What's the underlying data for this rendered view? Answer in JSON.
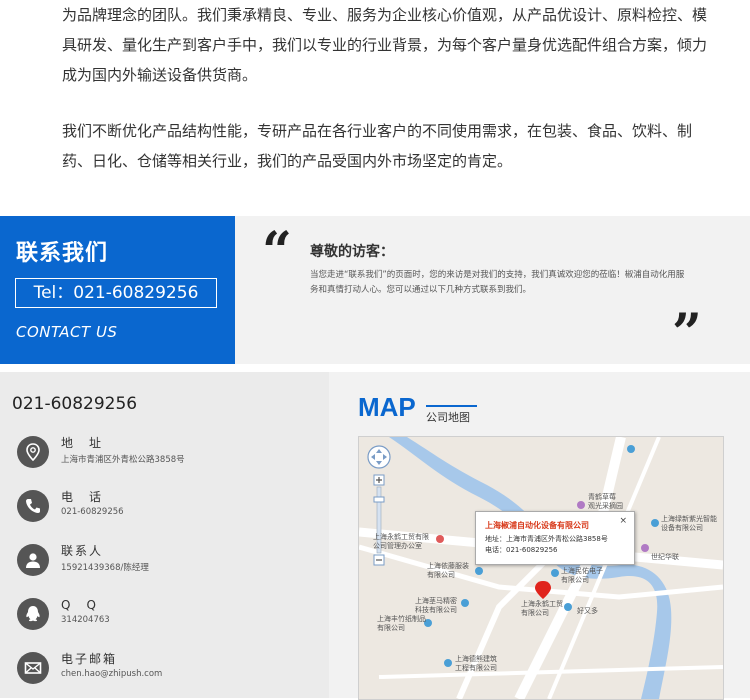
{
  "intro": {
    "paragraph1": "为品牌理念的团队。我们秉承精良、专业、服务为企业核心价值观，从产品优设计、原料检控、模具研发、量化生产到客户手中，我们以专业的行业背景，为每个客户量身优选配件组合方案，倾力成为国内外输送设备供货商。",
    "paragraph2": "我们不断优化产品结构性能，专研产品在各行业客户的不同使用需求，在包装、食品、饮料、制药、日化、仓储等相关行业，我们的产品受国内外市场坚定的肯定。"
  },
  "contact": {
    "title": "联系我们",
    "tel": "Tel：021-60829256",
    "subtitle": "CONTACT US",
    "visitor_title": "尊敬的访客：",
    "visitor_text": "当您走进“联系我们”的页面时，您的来访是对我们的支持，我们真诚欢迎您的莅临！椒浦自动化用服务和真情打动人心。您可以通过以下几种方式联系到我们。",
    "accent": "#0a67cf"
  },
  "info": {
    "phone": "021-60829256",
    "items": [
      {
        "icon": "location-icon",
        "label": "地　址",
        "value": "上海市青浦区外青松公路3858号"
      },
      {
        "icon": "phone-icon",
        "label": "电　话",
        "value": "021-60829256"
      },
      {
        "icon": "person-icon",
        "label": "联系人",
        "value": "15921439368/陈经理"
      },
      {
        "icon": "qq-icon",
        "label": "Q　Q",
        "value": "314204763"
      },
      {
        "icon": "mail-icon",
        "label": "电子邮箱",
        "value": "chen.hao@zhipush.com"
      }
    ]
  },
  "map": {
    "title": "MAP",
    "subtitle": "公司地图",
    "popup": {
      "title": "上海椒浦自动化设备有限公司",
      "address": "地址：上海市青浦区外青松公路3858号",
      "phone": "电话：021-60829256",
      "close": "×"
    },
    "pois": [
      "青鹤草莓\n观光采摘园",
      "上海绿新紫光智能\n设备有限公司",
      "上海永鹤工贸有限\n公司管理办公室",
      "世纪华联",
      "上海依藤服装\n有限公司",
      "上海民佑电子\n有限公司",
      "上海茎马精密\n科技有限公司",
      "上海永鹤工贸\n有限公司",
      "好又多",
      "上海丰竹纸制品\n有限公司",
      "上海德熊建筑\n工程有限公司"
    ]
  }
}
